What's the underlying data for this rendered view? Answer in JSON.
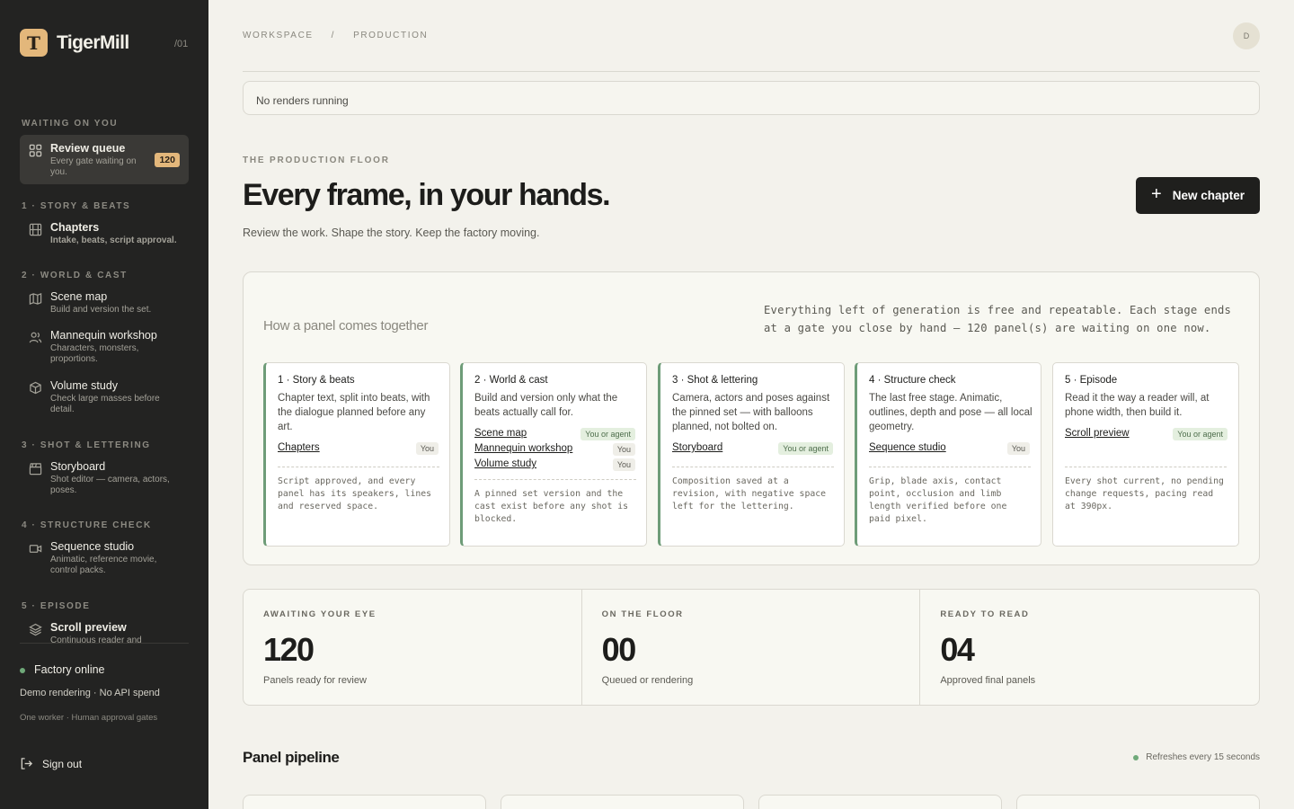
{
  "brand": {
    "name": "TigerMill",
    "logo_letter": "T",
    "version": "/01"
  },
  "sidebar": {
    "sections": [
      {
        "label": "WAITING ON YOU"
      },
      {
        "label": "1 · STORY & BEATS"
      },
      {
        "label": "2 · WORLD & CAST"
      },
      {
        "label": "3 · SHOT & LETTERING"
      },
      {
        "label": "4 · STRUCTURE CHECK"
      },
      {
        "label": "5 · EPISODE"
      }
    ],
    "items": [
      {
        "title": "Review queue",
        "desc": "Every gate waiting on you.",
        "badge": "120",
        "icon": "grid-icon"
      },
      {
        "title": "Chapters",
        "desc": "Intake, beats, script approval.",
        "icon": "film-icon"
      },
      {
        "title": "Scene map",
        "desc": "Build and version the set.",
        "icon": "map-icon"
      },
      {
        "title": "Mannequin workshop",
        "desc": "Characters, monsters, proportions.",
        "icon": "users-icon"
      },
      {
        "title": "Volume study",
        "desc": "Check large masses before detail.",
        "icon": "cube-icon"
      },
      {
        "title": "Storyboard",
        "desc": "Shot editor — camera, actors, poses.",
        "icon": "clapboard-icon"
      },
      {
        "title": "Sequence studio",
        "desc": "Animatic, reference movie, control packs.",
        "icon": "video-icon"
      },
      {
        "title": "Scroll preview",
        "desc": "Continuous reader and",
        "icon": "layers-icon"
      }
    ],
    "status": {
      "title": "Factory online",
      "sub": "Demo rendering · No API spend",
      "sub2": "One worker · Human approval gates"
    },
    "signout_label": "Sign out"
  },
  "header": {
    "breadcrumb": [
      "WORKSPACE",
      "/",
      "PRODUCTION"
    ],
    "avatar_initial": "D",
    "renders_status": "No renders running"
  },
  "hero": {
    "eyebrow": "THE PRODUCTION FLOOR",
    "title": "Every frame, in your hands.",
    "subtitle": "Review the work. Shape the story. Keep the factory moving.",
    "new_button": "New chapter"
  },
  "flow": {
    "title": "How a panel comes together",
    "description": "Everything left of generation is free and repeatable. Each stage ends at a gate you close by hand — 120 panel(s) are waiting on one now.",
    "stages": [
      {
        "title": "1 · Story & beats",
        "desc": "Chapter text, split into beats, with the dialogue planned before any art.",
        "links": [
          {
            "label": "Chapters",
            "tag": "You"
          }
        ],
        "gate": "Script approved, and every panel has its speakers, lines and reserved space."
      },
      {
        "title": "2 · World & cast",
        "desc": "Build and version only what the beats actually call for.",
        "links": [
          {
            "label": "Scene map",
            "tag": "You or agent"
          },
          {
            "label": "Mannequin workshop",
            "tag": "You"
          },
          {
            "label": "Volume study",
            "tag": "You"
          }
        ],
        "gate": "A pinned set version and the cast exist before any shot is blocked."
      },
      {
        "title": "3 · Shot & lettering",
        "desc": "Camera, actors and poses against the pinned set — with balloons planned, not bolted on.",
        "links": [
          {
            "label": "Storyboard",
            "tag": "You or agent"
          }
        ],
        "gate": "Composition saved at a revision, with negative space left for the lettering."
      },
      {
        "title": "4 · Structure check",
        "desc": "The last free stage. Animatic, outlines, depth and pose — all local geometry.",
        "links": [
          {
            "label": "Sequence studio",
            "tag": "You"
          }
        ],
        "gate": "Grip, blade axis, contact point, occlusion and limb length verified before one paid pixel."
      },
      {
        "title": "5 · Episode",
        "desc": "Read it the way a reader will, at phone width, then build it.",
        "links": [
          {
            "label": "Scroll preview",
            "tag": "You or agent"
          }
        ],
        "gate": "Every shot current, no pending change requests, pacing read at 390px."
      }
    ]
  },
  "stats": [
    {
      "label": "AWAITING YOUR EYE",
      "value": "120",
      "sub": "Panels ready for review"
    },
    {
      "label": "ON THE FLOOR",
      "value": "00",
      "sub": "Queued or rendering"
    },
    {
      "label": "READY TO READ",
      "value": "04",
      "sub": "Approved final panels"
    }
  ],
  "pipeline": {
    "title": "Panel pipeline",
    "refresh": "Refreshes every 15 seconds"
  },
  "colors": {
    "sidebar_bg": "#232322",
    "accent": "#e3b77b",
    "page_bg": "#f3f2ec",
    "online": "#6fa979",
    "stage_done": "#6e9c78"
  }
}
